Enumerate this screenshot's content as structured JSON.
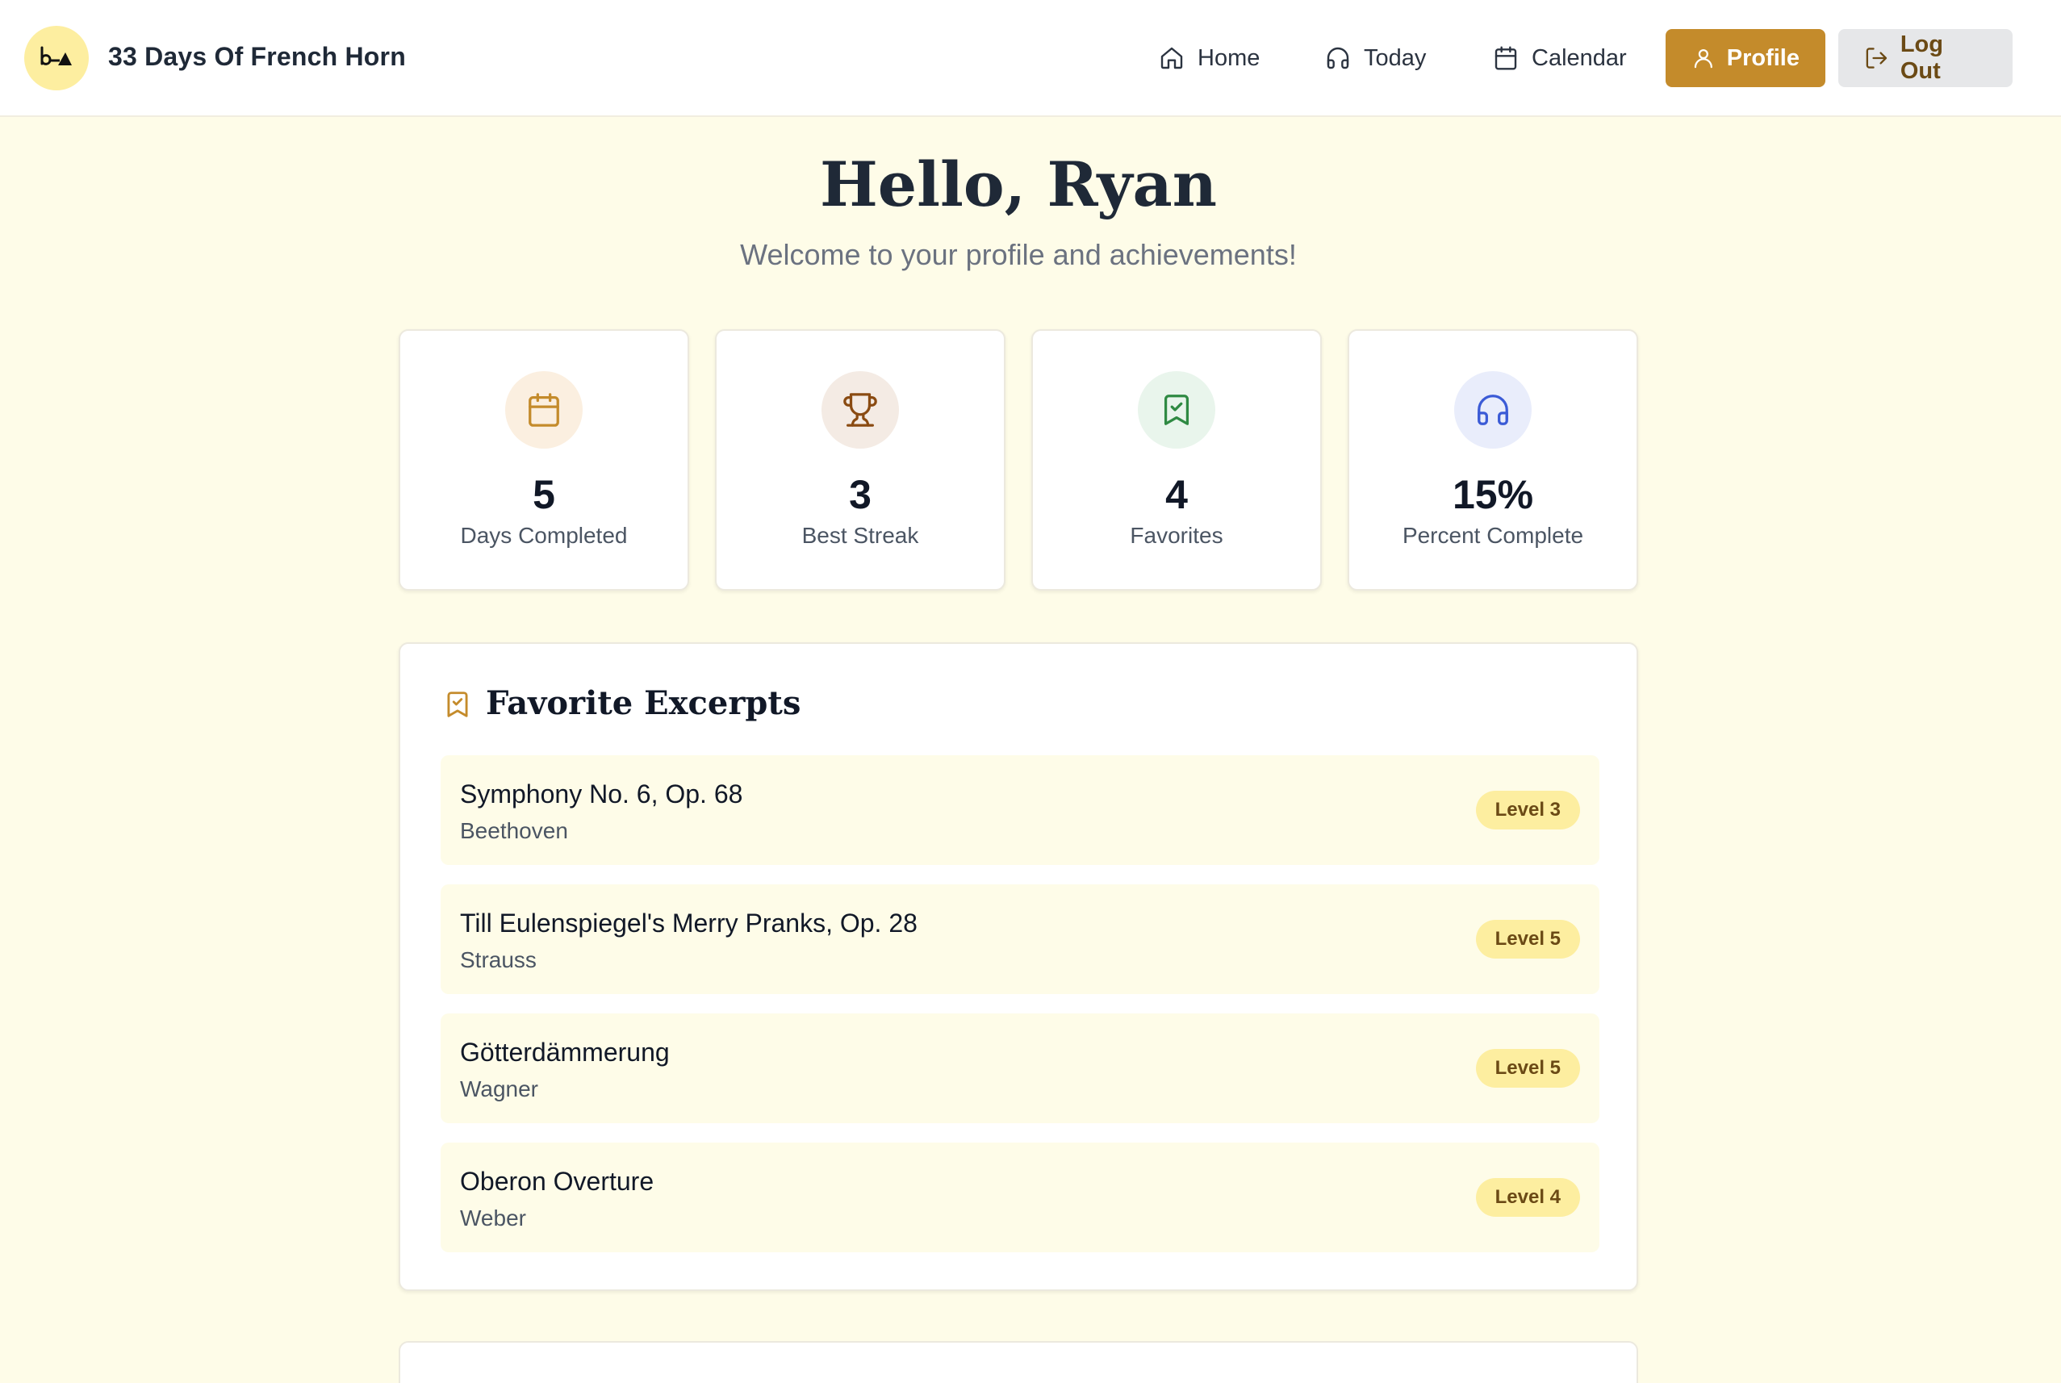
{
  "app": {
    "title": "33 Days Of French Horn"
  },
  "nav": {
    "home": "Home",
    "today": "Today",
    "calendar": "Calendar",
    "profile": "Profile",
    "logout": "Log Out"
  },
  "greeting": {
    "title": "Hello, Ryan",
    "subtitle": "Welcome to your profile and achievements!"
  },
  "stats": [
    {
      "value": "5",
      "label": "Days Completed",
      "icon": "calendar-icon",
      "icon_color": "#c48b2b",
      "bg": "#fbefe0"
    },
    {
      "value": "3",
      "label": "Best Streak",
      "icon": "trophy-icon",
      "icon_color": "#8a4b12",
      "bg": "#f4ebe4"
    },
    {
      "value": "4",
      "label": "Favorites",
      "icon": "bookmark-check-icon",
      "icon_color": "#2f8a43",
      "bg": "#e9f5ec"
    },
    {
      "value": "15%",
      "label": "Percent Complete",
      "icon": "headphones-icon",
      "icon_color": "#3b5bd6",
      "bg": "#e9edfb"
    }
  ],
  "favorites": {
    "title": "Favorite Excerpts",
    "items": [
      {
        "title": "Symphony No. 6, Op. 68",
        "composer": "Beethoven",
        "level": "Level 3"
      },
      {
        "title": "Till Eulenspiegel's Merry Pranks, Op. 28",
        "composer": "Strauss",
        "level": "Level 5"
      },
      {
        "title": "Götterdämmerung",
        "composer": "Wagner",
        "level": "Level 5"
      },
      {
        "title": "Oberon Overture",
        "composer": "Weber",
        "level": "Level 4"
      }
    ]
  },
  "colors": {
    "accent": "#c48b2b",
    "background": "#fefce8",
    "badge": "#fdeea0"
  }
}
